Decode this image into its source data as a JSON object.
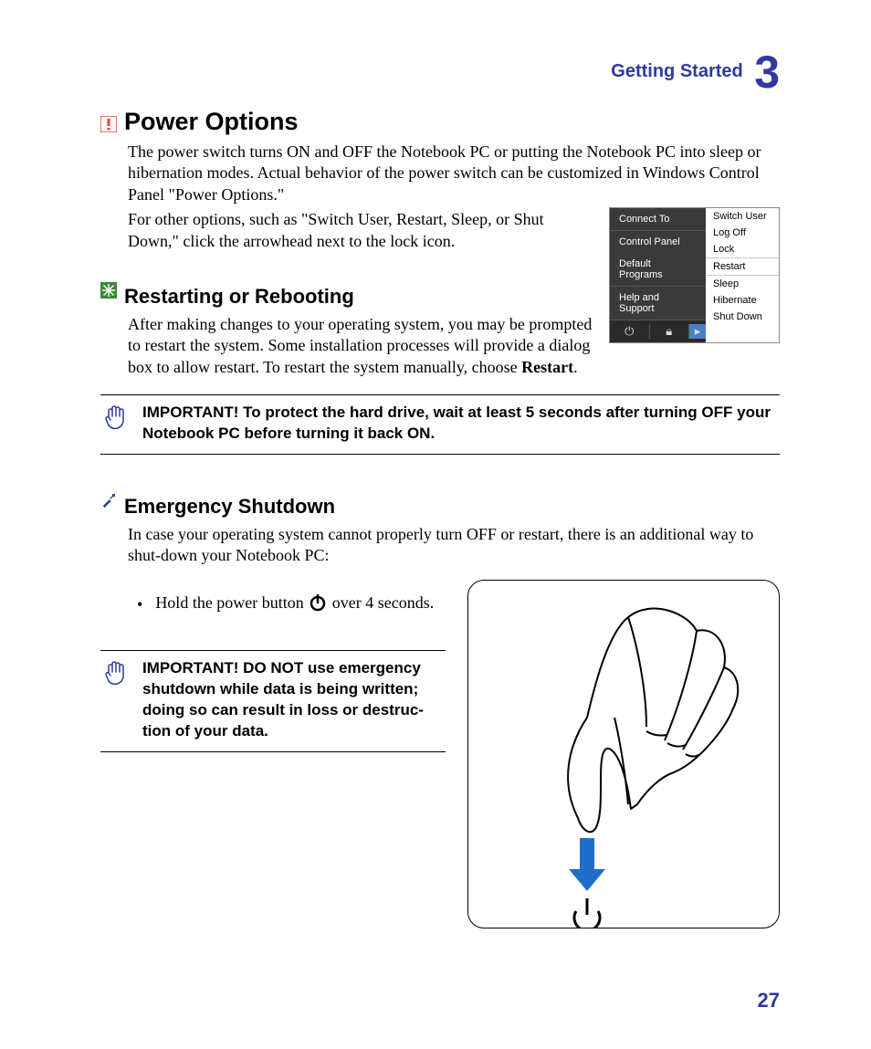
{
  "header": {
    "chapter_title": "Getting Started",
    "chapter_number": "3"
  },
  "sections": {
    "power_options": {
      "heading": "Power Options",
      "para1": "The power switch turns ON and OFF the Notebook PC or putting the Notebook PC into sleep or hibernation modes. Actual behavior of the power switch can be customized in Windows Control Panel \"Power Options.\"",
      "para2": "For other options, such as \"Switch User, Restart, Sleep, or Shut Down,\" click the arrowhead next to the lock icon."
    },
    "restarting": {
      "heading": "Restarting or Rebooting",
      "para_prefix": "After making changes to your operating system, you may be prompted to restart the system. Some installation processes will provide a dialog box to allow restart. To restart the system manually, choose ",
      "para_bold": "Restart",
      "para_suffix": "."
    },
    "important1": "IMPORTANT!  To protect the hard drive, wait at least 5 seconds after turning OFF your Notebook PC before turning it back ON.",
    "emergency": {
      "heading": "Emergency Shutdown",
      "para": "In case your operating system cannot properly turn OFF or restart, there is an additional way to shut-down your Notebook PC:",
      "bullet_prefix": "Hold the power button ",
      "bullet_suffix": " over 4 seconds."
    },
    "important2": "IMPORTANT!  DO NOT use emergency shutdown while data is being written; doing so can result in loss or destruc-tion of your data."
  },
  "menu": {
    "left": [
      "Connect To",
      "Control Panel",
      "Default Programs",
      "Help and Support"
    ],
    "right": [
      "Switch User",
      "Log Off",
      "Lock",
      "Restart",
      "Sleep",
      "Hibernate",
      "Shut Down"
    ]
  },
  "page_number": "27"
}
